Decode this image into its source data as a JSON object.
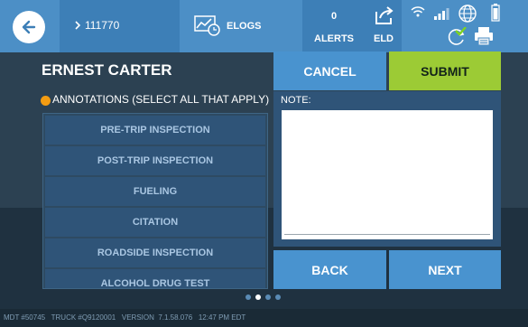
{
  "header": {
    "driver_id": "111770",
    "elogs_label": "ELOGS",
    "alerts_count": "0",
    "alerts_label": "ALERTS",
    "eld_label": "ELD"
  },
  "icons": {
    "back": "back-arrow-icon",
    "chevron": "chevron-right-icon",
    "elogs": "elogs-graph-icon",
    "eld": "share-arrow-icon",
    "wifi": "wifi-icon",
    "signal": "signal-bars-icon",
    "globe": "globe-icon",
    "battery": "battery-icon",
    "sync": "sync-check-icon",
    "printer": "printer-icon"
  },
  "driver": {
    "name": "ERNEST CARTER"
  },
  "annotations": {
    "title": "ANNOTATIONS (SELECT ALL THAT APPLY)",
    "items": [
      "PRE-TRIP INSPECTION",
      "POST-TRIP INSPECTION",
      "FUELING",
      "CITATION",
      "ROADSIDE INSPECTION",
      "ALCOHOL DRUG TEST"
    ]
  },
  "actions": {
    "cancel": "CANCEL",
    "submit": "SUBMIT",
    "back": "BACK",
    "next": "NEXT"
  },
  "note": {
    "label": "NOTE:",
    "value": ""
  },
  "pagination": {
    "total": 4,
    "current": 2
  },
  "footer": {
    "text": "MDT #50745   TRUCK #Q9120001   VERSION  7.1.58.076   12:47 PM EDT"
  },
  "colors": {
    "accent_blue": "#4993cf",
    "submit_green": "#9ccb35",
    "annotation_dot": "#f39c12"
  }
}
